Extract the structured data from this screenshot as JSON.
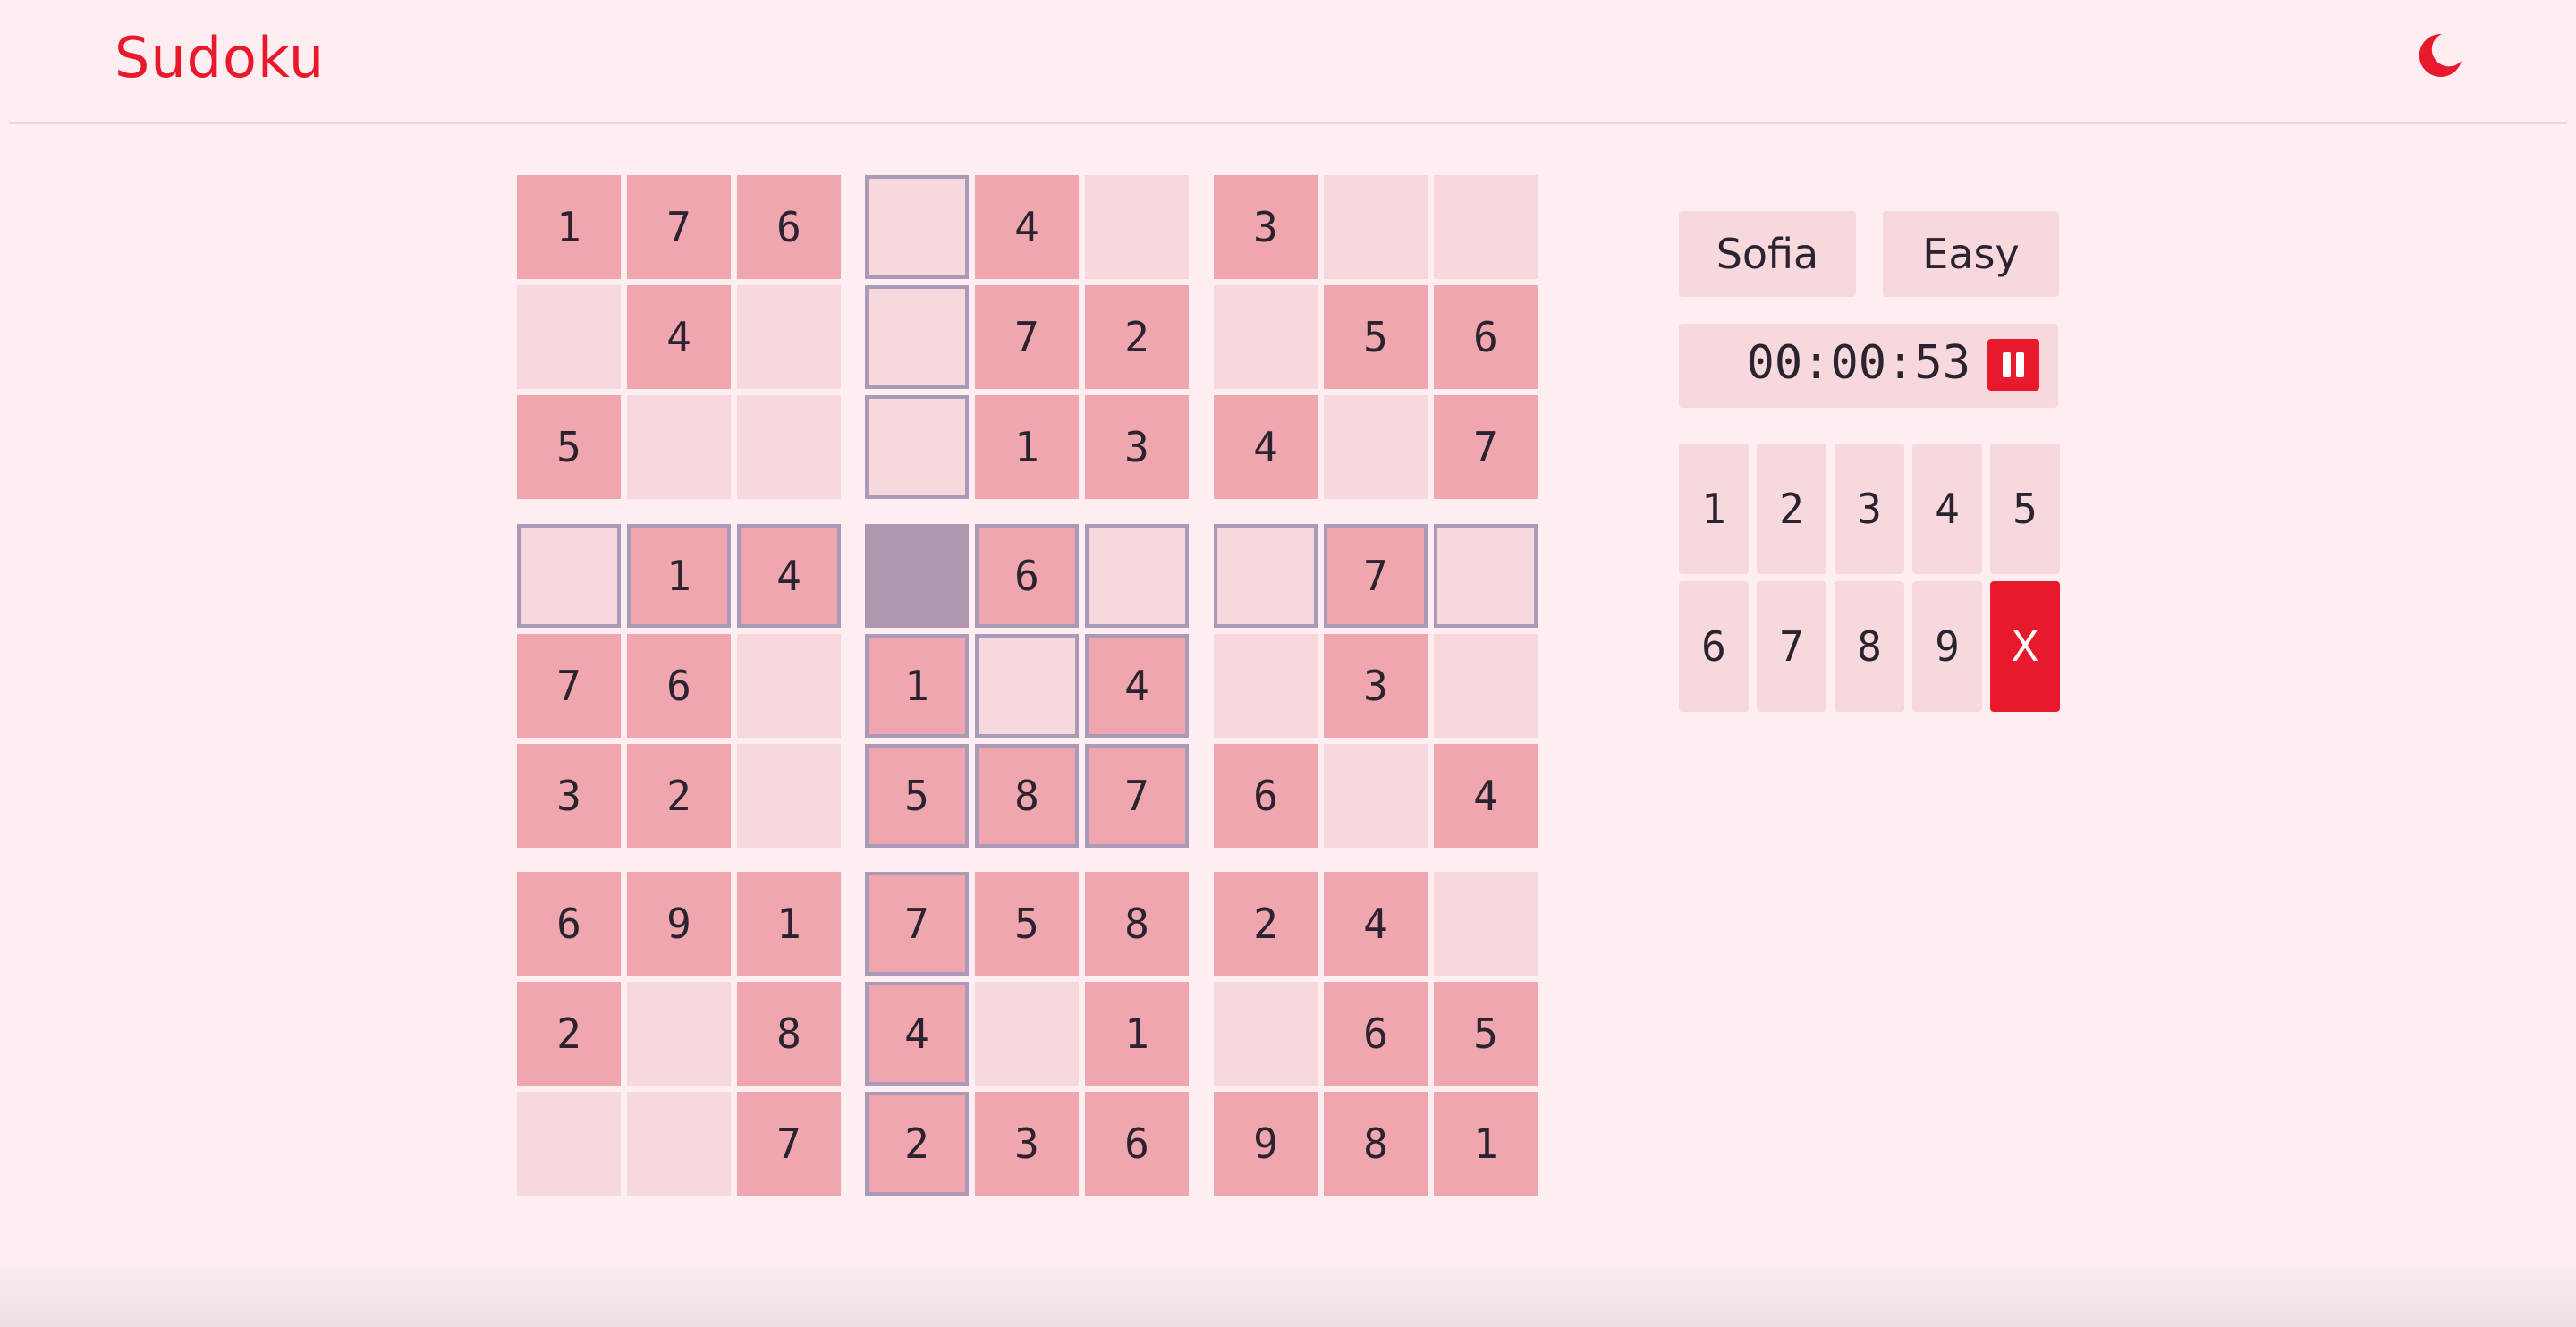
{
  "header": {
    "title": "Sudoku",
    "theme_icon": "moon-icon"
  },
  "colors": {
    "accent": "#E8192C",
    "background": "#FFEEF1",
    "given_cell": "#EFA6AE",
    "empty_cell": "#F7D9DD",
    "highlight_border": "#A99AB8",
    "selected_cell": "#AE97AE"
  },
  "board": {
    "rows": [
      [
        "1",
        "7",
        "6",
        "",
        "4",
        "",
        "3",
        "",
        ""
      ],
      [
        "",
        "4",
        "",
        "",
        "7",
        "2",
        "",
        "5",
        "6"
      ],
      [
        "5",
        "",
        "",
        "",
        "1",
        "3",
        "4",
        "",
        "7"
      ],
      [
        "",
        "1",
        "4",
        "",
        "6",
        "",
        "",
        "7",
        ""
      ],
      [
        "7",
        "6",
        "",
        "1",
        "",
        "4",
        "",
        "3",
        ""
      ],
      [
        "3",
        "2",
        "",
        "5",
        "8",
        "7",
        "6",
        "",
        "4"
      ],
      [
        "6",
        "9",
        "1",
        "7",
        "5",
        "8",
        "2",
        "4",
        ""
      ],
      [
        "2",
        "",
        "8",
        "4",
        "",
        "1",
        "",
        "6",
        "5"
      ],
      [
        "",
        "",
        "7",
        "2",
        "3",
        "6",
        "9",
        "8",
        "1"
      ]
    ],
    "selected": {
      "row": 3,
      "col": 3
    }
  },
  "panel": {
    "player": "Sofia",
    "difficulty": "Easy",
    "timer": "00:00:53",
    "pause_icon": "pause-icon",
    "keys": [
      "1",
      "2",
      "3",
      "4",
      "5",
      "6",
      "7",
      "8",
      "9"
    ],
    "erase_label": "X"
  }
}
